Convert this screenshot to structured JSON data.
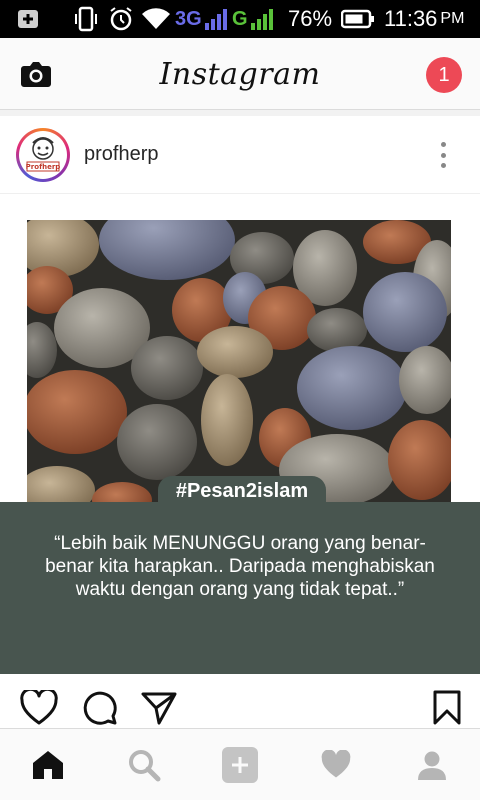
{
  "status_bar": {
    "net_3g": "3G",
    "net_g": "G",
    "battery": "76%",
    "time": "11:36",
    "ampm": "PM"
  },
  "header": {
    "logo": "Instagram",
    "notification_count": "1"
  },
  "post": {
    "username": "profherp",
    "avatar_text": "Profherp",
    "hashtag": "#Pesan2islam",
    "quote": "“Lebih baik MENUNGGU orang yang benar-benar kita harapkan.. Daripada menghabiskan waktu dengan orang yang tidak tepat..”"
  },
  "colors": {
    "notification": "#ed4956",
    "quote_panel": "#48554f"
  },
  "icons": {
    "top_left": "camera-icon",
    "post_more": "more-vertical-icon",
    "actions": [
      "heart-icon",
      "comment-icon",
      "share-icon",
      "bookmark-icon"
    ],
    "bottom_nav": [
      "home-icon",
      "search-icon",
      "add-icon",
      "activity-icon",
      "profile-icon"
    ]
  }
}
